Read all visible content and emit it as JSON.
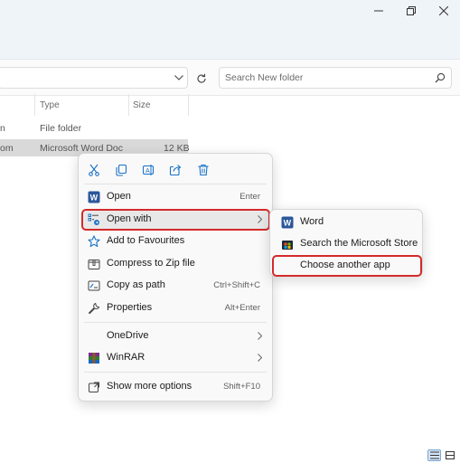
{
  "window": {
    "maximize_icon": "restore-icon",
    "close_icon": "close-icon"
  },
  "address": {
    "dropdown_icon": "chevron-down-icon",
    "refresh_icon": "refresh-icon"
  },
  "search": {
    "placeholder": "Search New folder"
  },
  "columns": [
    "Type",
    "Size"
  ],
  "rows": [
    {
      "name": "n",
      "type": "File folder",
      "size": ""
    },
    {
      "name": "om",
      "type": "Microsoft Word Doc",
      "size": "12 KB"
    }
  ],
  "context_menu": {
    "quick_actions": [
      "cut-icon",
      "copy-icon",
      "rename-icon",
      "share-icon",
      "delete-icon"
    ],
    "items": [
      {
        "label": "Open",
        "shortcut": "Enter",
        "icon": "word-icon"
      },
      {
        "label": "Open with",
        "shortcut": "",
        "icon": "open-with-icon",
        "submenu": true
      },
      {
        "label": "Add to Favourites",
        "shortcut": "",
        "icon": "star-icon"
      },
      {
        "label": "Compress to Zip file",
        "shortcut": "",
        "icon": "zip-icon"
      },
      {
        "label": "Copy as path",
        "shortcut": "Ctrl+Shift+C",
        "icon": "path-icon"
      },
      {
        "label": "Properties",
        "shortcut": "Alt+Enter",
        "icon": "wrench-icon"
      },
      {
        "label": "OneDrive",
        "shortcut": "",
        "icon": "",
        "submenu": true
      },
      {
        "label": "WinRAR",
        "shortcut": "",
        "icon": "winrar-icon",
        "submenu": true
      },
      {
        "label": "Show more options",
        "shortcut": "Shift+F10",
        "icon": "more-options-icon"
      }
    ]
  },
  "open_with_submenu": {
    "items": [
      {
        "label": "Word",
        "icon": "word-icon"
      },
      {
        "label": "Search the Microsoft Store",
        "icon": "store-icon"
      },
      {
        "label": "Choose another app",
        "icon": ""
      }
    ]
  },
  "colors": {
    "highlight_red": "#d42a2a",
    "word_blue": "#2b579a",
    "accent_blue": "#1a73c8"
  }
}
